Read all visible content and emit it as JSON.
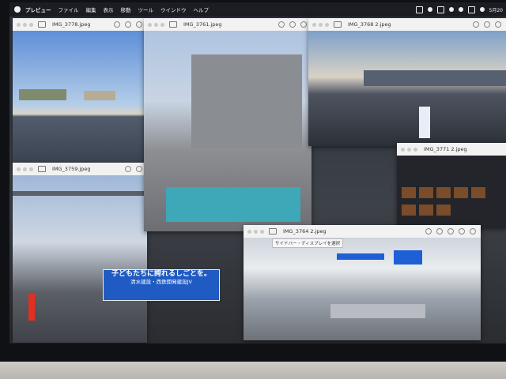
{
  "menubar": {
    "apple_icon": "apple-icon",
    "items": [
      "プレビュー",
      "ファイル",
      "編集",
      "表示",
      "移動",
      "ツール",
      "ウインドウ",
      "ヘルプ"
    ],
    "clock": "5月20"
  },
  "windows": [
    {
      "id": "img3778",
      "title": "IMG_3778.jpeg"
    },
    {
      "id": "img3761",
      "title": "IMG_3761.jpeg"
    },
    {
      "id": "img3768",
      "title": "IMG_3768 2.jpeg"
    },
    {
      "id": "img3759",
      "title": "IMG_3759.jpeg"
    },
    {
      "id": "img3771",
      "title": "IMG_3771 2.jpeg"
    },
    {
      "id": "img3764",
      "title": "IMG_3764 2.jpeg"
    }
  ],
  "tooltip": "サイドバー・ディスプレイを選択",
  "banner": {
    "main": "子どもたちに誇れるしごとを。",
    "sub": "清水建設・西鉄開発建設JV"
  }
}
